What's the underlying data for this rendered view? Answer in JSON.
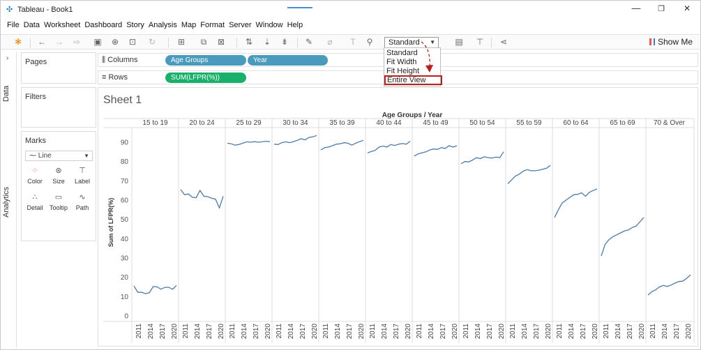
{
  "window": {
    "title": "Tableau - Book1",
    "minimize": "—",
    "maximize": "❐",
    "close": "✕"
  },
  "menu": [
    "File",
    "Data",
    "Worksheet",
    "Dashboard",
    "Story",
    "Analysis",
    "Map",
    "Format",
    "Server",
    "Window",
    "Help"
  ],
  "toolbar": {
    "view_select": "Standard",
    "show_me": "Show Me"
  },
  "fit_dropdown": {
    "options": [
      "Standard",
      "Fit Width",
      "Fit Height",
      "Entire View"
    ],
    "highlighted": "Entire View",
    "highlight_color": "#b22222"
  },
  "side_tabs": [
    "Data",
    "Analytics"
  ],
  "cards": {
    "pages": "Pages",
    "filters": "Filters",
    "marks": "Marks",
    "mark_type": "Line",
    "mark_buttons": [
      {
        "label": "Color",
        "icon": "color-icon"
      },
      {
        "label": "Size",
        "icon": "size-icon"
      },
      {
        "label": "Label",
        "icon": "label-icon"
      },
      {
        "label": "Detail",
        "icon": "detail-icon"
      },
      {
        "label": "Tooltip",
        "icon": "tooltip-icon"
      },
      {
        "label": "Path",
        "icon": "path-icon"
      }
    ]
  },
  "shelves": {
    "columns_label": "Columns",
    "rows_label": "Rows",
    "columns_pills": [
      "Age Groups",
      "Year"
    ],
    "rows_pills": [
      "SUM(LFPR(%))"
    ],
    "dimension_color": "#4a9abd",
    "measure_color": "#1aaf6a"
  },
  "sheet": {
    "title": "Sheet 1"
  },
  "chart_data": {
    "type": "line",
    "title": "Age Groups / Year",
    "ylabel": "Sum of LFPR(%)",
    "ylim": [
      0,
      95
    ],
    "yticks": [
      0,
      10,
      20,
      30,
      40,
      50,
      60,
      70,
      80,
      90
    ],
    "x_tick_labels": [
      "2011",
      "2014",
      "2017",
      "2020"
    ],
    "years": [
      2011,
      2012,
      2013,
      2014,
      2015,
      2016,
      2017,
      2018,
      2019,
      2020
    ],
    "line_color": "#4e79a7",
    "grid": "vertical panel dividers",
    "panels": [
      {
        "group": "15 to 19",
        "values": [
          15.5,
          12.2,
          12.2,
          11.5,
          12.0,
          15.2,
          15.0,
          13.8,
          14.8,
          14.8,
          13.8,
          15.8
        ]
      },
      {
        "group": "20 to 24",
        "values": [
          65.5,
          62.8,
          63.2,
          61.5,
          61.2,
          65.0,
          62.0,
          61.8,
          61.0,
          60.5,
          56.0,
          62.0
        ]
      },
      {
        "group": "25 to 29",
        "values": [
          89.5,
          89.2,
          88.5,
          88.8,
          89.5,
          90.2,
          90.0,
          90.3,
          90.0,
          90.2,
          90.5,
          90.3
        ]
      },
      {
        "group": "30 to 34",
        "values": [
          89.0,
          88.8,
          89.8,
          90.2,
          89.8,
          90.3,
          91.0,
          91.8,
          91.2,
          92.5,
          92.8,
          93.5
        ]
      },
      {
        "group": "35 to 39",
        "values": [
          86.0,
          87.2,
          87.5,
          88.2,
          89.0,
          89.2,
          89.8,
          89.5,
          88.5,
          89.5,
          90.3,
          91.0
        ]
      },
      {
        "group": "40 to 44",
        "values": [
          84.5,
          85.2,
          85.8,
          87.5,
          88.0,
          87.5,
          88.8,
          88.3,
          89.0,
          89.3,
          89.0,
          90.5
        ]
      },
      {
        "group": "45 to 49",
        "values": [
          82.8,
          84.0,
          84.5,
          85.0,
          86.0,
          86.5,
          86.3,
          87.2,
          86.8,
          88.2,
          87.5,
          88.2
        ]
      },
      {
        "group": "50 to 54",
        "values": [
          78.8,
          80.0,
          79.8,
          80.8,
          82.0,
          81.5,
          82.5,
          82.0,
          81.8,
          82.3,
          82.0,
          85.0
        ]
      },
      {
        "group": "55 to 59",
        "values": [
          68.5,
          70.5,
          72.5,
          73.5,
          75.0,
          75.8,
          75.2,
          75.2,
          75.5,
          76.0,
          76.5,
          78.0
        ]
      },
      {
        "group": "60 to 64",
        "values": [
          51.0,
          55.0,
          58.5,
          60.0,
          61.5,
          62.8,
          63.0,
          63.8,
          62.0,
          64.0,
          65.0,
          65.8
        ]
      },
      {
        "group": "65 to 69",
        "values": [
          31.0,
          37.0,
          39.5,
          41.0,
          42.0,
          43.0,
          44.0,
          44.5,
          45.8,
          46.5,
          48.8,
          51.0
        ]
      },
      {
        "group": "70 & Over",
        "values": [
          10.8,
          12.5,
          13.5,
          15.0,
          15.8,
          15.2,
          16.0,
          17.0,
          17.8,
          18.0,
          19.5,
          21.2
        ]
      }
    ]
  }
}
